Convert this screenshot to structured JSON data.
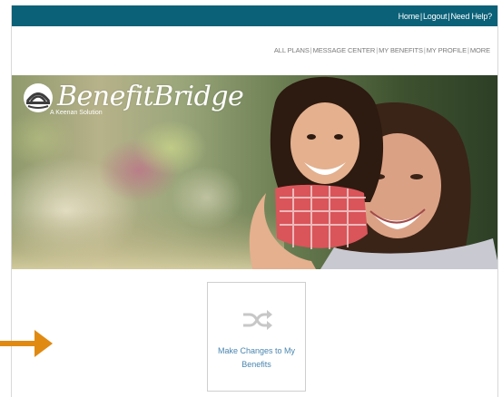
{
  "utility_nav": {
    "home": "Home",
    "logout": "Logout",
    "help": "Need Help?",
    "separator": "|"
  },
  "main_nav": {
    "items": [
      "ALL PLANS",
      "MESSAGE CENTER",
      "MY BENEFITS",
      "MY PROFILE",
      "MORE"
    ],
    "separator": "|"
  },
  "brand": {
    "name": "BenefitBridge",
    "tagline": "A Keenan Solution"
  },
  "action_card": {
    "icon": "shuffle-icon",
    "label": "Make Changes to My Benefits"
  },
  "colors": {
    "utility_bar": "#0b6178",
    "card_text": "#4a86b0",
    "arrow": "#e08a12"
  }
}
